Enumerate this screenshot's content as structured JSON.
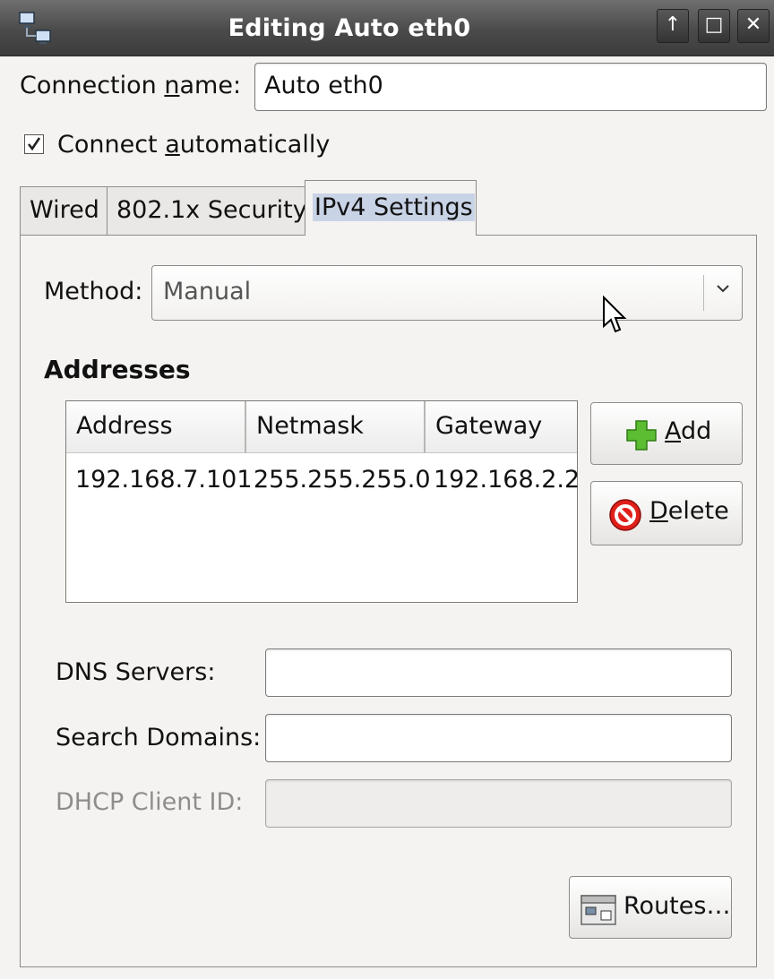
{
  "window": {
    "title": "Editing Auto eth0",
    "controls": [
      "↑",
      "□",
      "✕"
    ]
  },
  "connection_name": {
    "label_pre": "Connection ",
    "label_acc": "n",
    "label_post": "ame:",
    "value": "Auto eth0"
  },
  "connect_auto": {
    "label_pre": "Connect ",
    "label_acc": "a",
    "label_post": "utomatically",
    "checked": true
  },
  "tabs": [
    {
      "label": "Wired"
    },
    {
      "label": "802.1x Security"
    },
    {
      "label": "IPv4 Settings"
    }
  ],
  "ipv4": {
    "method_label": "Method:",
    "method_value": "Manual",
    "addresses_heading": "Addresses",
    "columns": [
      "Address",
      "Netmask",
      "Gateway"
    ],
    "rows": [
      [
        "192.168.7.101",
        "255.255.255.0",
        "192.168.2.2"
      ]
    ],
    "add_button": {
      "acc": "A",
      "rest": "dd"
    },
    "delete_button": {
      "acc": "D",
      "rest": "elete"
    },
    "dns_label": "DNS Servers:",
    "dns_value": "",
    "search_label": "Search Domains:",
    "search_value": "",
    "dhcp_label": "DHCP Client ID:",
    "dhcp_value": "",
    "routes_button": "Routes…"
  },
  "colors": {
    "titlebar": "#4a4a4a",
    "tab_selected_highlight": "#c9d3e6",
    "add_icon": "#4caf2a",
    "delete_icon": "#d01818"
  }
}
